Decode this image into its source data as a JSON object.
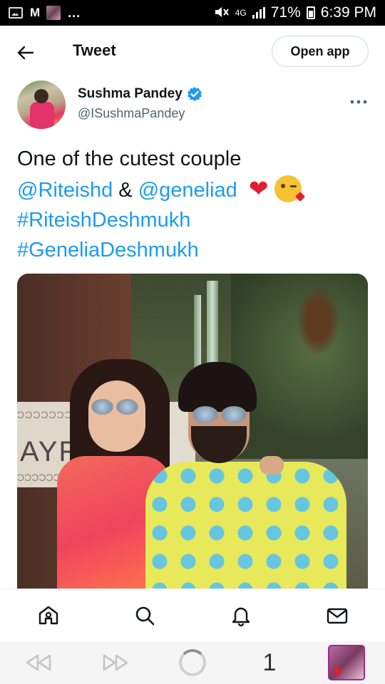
{
  "status_bar": {
    "notif_dots": "...",
    "network": "4G",
    "battery": "71%",
    "time": "6:39 PM"
  },
  "header": {
    "title": "Tweet",
    "open_app_label": "Open app"
  },
  "tweet": {
    "author_name": "Sushma Pandey",
    "author_handle": "@ISushmaPandey",
    "text_line1": "One of the cutest couple",
    "mention1": "@Riteishd",
    "amp": "&",
    "mention2": "@geneliad",
    "hashtag1": "#RiteishDeshmukh",
    "hashtag2": "#GeneliaDeshmukh",
    "photo_sign_text": "AYR",
    "photo_sign_pattern": "ƆƆƆƆƆƆƆƆƆƆƆƆƆƆƆ"
  },
  "colors": {
    "link": "#1d9bf0",
    "verified": "#1d9bf0",
    "text": "#0f1419",
    "secondary": "#536471"
  },
  "bottom_nav": {
    "items": [
      "home-icon",
      "search-icon",
      "notifications-icon",
      "messages-icon"
    ]
  },
  "browser_bar": {
    "tab_count": "1"
  }
}
